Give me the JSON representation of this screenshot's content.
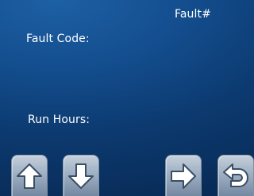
{
  "screen": {
    "title": "Fault#",
    "fault_code_label": "Fault Code:",
    "run_hours_label": "Run Hours:"
  },
  "buttons": [
    {
      "icon": "arrow-up-icon"
    },
    {
      "icon": "arrow-down-icon"
    },
    {
      "icon": "arrow-right-icon"
    },
    {
      "icon": "back-return-icon"
    }
  ],
  "colors": {
    "background_top": "#1d60a4",
    "background_bottom": "#082a55",
    "button_face": "#9fb0c4",
    "icon_fill": "#ffffff",
    "text": "#ffffff"
  }
}
